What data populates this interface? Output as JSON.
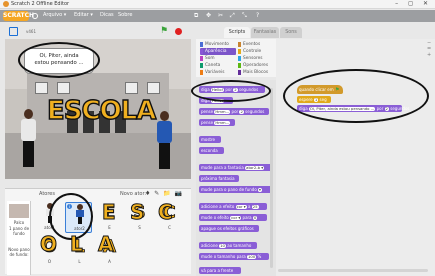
{
  "window": {
    "title": "Scratch 2 Offline Editor",
    "controls": "– ◻ ✕"
  },
  "menubar": {
    "logo": "SCRATCH",
    "items": [
      "Arquivo ▾",
      "Editar ▾",
      "Dicas",
      "Sobre"
    ],
    "tools": [
      "⧉",
      "✥",
      "✂",
      "⤢",
      "⤡",
      "?"
    ]
  },
  "stage_toolbar": {
    "version": "v461"
  },
  "stage": {
    "sign": "ESCOLA",
    "speech_lines": [
      "Oi, Piter, ainda",
      "estou pensando ..."
    ]
  },
  "sprites": {
    "header": "Atores",
    "new_sprite_label": "Novo ator:",
    "new_sprite_icons": "♦ ✎ 📁 📷",
    "stage_label": "Palco",
    "stage_sub": "1 pano de fundo",
    "new_backdrop": "Novo pano de fundo:",
    "tiles_row1": [
      {
        "name": "ator1",
        "kind": "person"
      },
      {
        "name": "ator2",
        "kind": "person",
        "selected": true
      },
      {
        "name": "E",
        "kind": "letter"
      },
      {
        "name": "S",
        "kind": "letter"
      },
      {
        "name": "C",
        "kind": "letter"
      }
    ],
    "tiles_row2": [
      {
        "name": "O",
        "kind": "letter"
      },
      {
        "name": "L",
        "kind": "letter"
      },
      {
        "name": "A",
        "kind": "letter"
      }
    ]
  },
  "tabs": [
    "Scripts",
    "Fantasias",
    "Sons"
  ],
  "categories": [
    {
      "label": "Movimento",
      "color": "#4a6cd4"
    },
    {
      "label": "Aparência",
      "color": "#8a55d7",
      "selected": true
    },
    {
      "label": "Som",
      "color": "#bb42c3"
    },
    {
      "label": "Caneta",
      "color": "#0e9a6c"
    },
    {
      "label": "Variáveis",
      "color": "#ee7d16"
    },
    {
      "label": "Eventos",
      "color": "#c88330"
    },
    {
      "label": "Controle",
      "color": "#e1a91a"
    },
    {
      "label": "Sensores",
      "color": "#2ca5e2"
    },
    {
      "label": "Operadores",
      "color": "#5cb712"
    },
    {
      "label": "Mais Blocos",
      "color": "#632d99"
    }
  ],
  "palette_blocks": [
    {
      "text": "diga",
      "slot": "Hello!",
      "after": "por",
      "slot2": "2",
      "tail": "segundos"
    },
    {
      "text": "diga",
      "slot": "Hello!"
    },
    {
      "text": "pense",
      "slot": "Hmm...",
      "after": "por",
      "slot2": "2",
      "tail": "segundos"
    },
    {
      "text": "pense",
      "slot": "Hmm..."
    },
    {
      "text": "mostre"
    },
    {
      "text": "esconda"
    },
    {
      "text": "mude para a fantasia",
      "slot": "ator2-b ▾"
    },
    {
      "text": "próxima fantasia"
    },
    {
      "text": "mude para o pano de fundo",
      "slot": "▾"
    },
    {
      "text": "adicione a efeito",
      "slot": "cor ▾",
      "after": "a",
      "slot2": "25"
    },
    {
      "text": "mude o efeito",
      "slot": "cor ▾",
      "after": "para",
      "slot2": "0"
    },
    {
      "text": "apague os efeitos gráficos"
    },
    {
      "text": "adicione",
      "slot": "10",
      "after": "ao tamanho"
    },
    {
      "text": "mude o tamanho para",
      "slot": "100",
      "after": "%"
    },
    {
      "text": "vá para a frente"
    }
  ],
  "script": {
    "hat": "quando clicar em",
    "blocks": [
      {
        "text": "espere",
        "slot": "1",
        "after": "seg",
        "color": "#e1a91a"
      },
      {
        "text": "diga",
        "slot": "Oi, Piter, ainda estou pensando ...",
        "after": "por",
        "slot2": "2",
        "tail": "segundos",
        "color": "#8a5ed6"
      }
    ]
  },
  "zoom": [
    "−",
    "=",
    "+"
  ]
}
